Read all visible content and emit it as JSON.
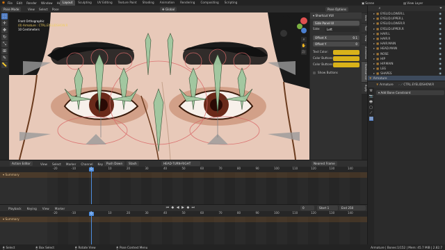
{
  "top_menu": {
    "items": [
      "File",
      "Edit",
      "Render",
      "Window",
      "Help"
    ],
    "workspaces": [
      "Layout",
      "Sculpting",
      "UV Editing",
      "Texture Paint",
      "Shading",
      "Animation",
      "Rendering",
      "Compositing",
      "Scripting"
    ],
    "active_workspace": "Layout",
    "scene_label": "Scene",
    "view_layer_label": "View Layer"
  },
  "viewport_header": {
    "mode": "Pose Mode",
    "menus": [
      "View",
      "Select",
      "Pose"
    ],
    "orientation": "Global",
    "pose_options": "Pose Options"
  },
  "viewport_info": {
    "line1": "Front Orthographic",
    "line2": "(0) Armature : CTRL.EYELIDSHOW.R",
    "line3": "10 Centimeters"
  },
  "side_panel": {
    "title": "Shortcut VUI",
    "dropdown": "Side Panel UI",
    "side_label": "Side:",
    "side_value": "Left",
    "offset_x_label": "Offset X",
    "offset_x_value": "0.1",
    "offset_y_label": "Offset Y",
    "offset_y_value": "0",
    "rows": [
      {
        "label": "Text Color:"
      },
      {
        "label": "Color Buttons:"
      },
      {
        "label": "Color Buttons ac:"
      }
    ],
    "show_buttons": "Show Buttons",
    "swatch_color": "#d9b21a",
    "tabs": [
      "Item",
      "Tool",
      "View",
      "Animation",
      "Shortcut VUI",
      "Rigify"
    ]
  },
  "outliner": {
    "items": [
      "EYELID.LOWER.L",
      "EYELID.UPPER.L",
      "EYELID.LOWER.R",
      "EYELID.UPPER.R",
      "HAIR.L",
      "HAIR.R",
      "HAIR.MAIN",
      "HEAD.MAIN",
      "NOSE",
      "HIP",
      "HIP.MAIN",
      "LEG",
      "SHAPES"
    ],
    "armature_row": "Armature"
  },
  "properties": {
    "object": "Armature",
    "bone": "CTRL.EYELIDSHOW.R",
    "add_constraint": "Add Bone Constraint"
  },
  "action_editor": {
    "mode": "Action Editor",
    "menus": [
      "View",
      "Select",
      "Marker",
      "Channel",
      "Key"
    ],
    "push_down": "Push Down",
    "stash": "Stash",
    "action_name": "HEAD-TURN-RIGHT",
    "snapping": "Nearest Frame",
    "summary": "Summary",
    "current_frame": "0",
    "ruler": [
      "-20",
      "-10",
      "0",
      "10",
      "20",
      "30",
      "40",
      "50",
      "60",
      "70",
      "80",
      "90",
      "100",
      "110",
      "120",
      "130",
      "140"
    ]
  },
  "timeline": {
    "menus": [
      "Playback",
      "Keying",
      "View",
      "Marker"
    ],
    "frame": "0",
    "start_label": "Start",
    "start": "1",
    "end_label": "End",
    "end": "250",
    "summary": "Summary",
    "ruler": [
      "-20",
      "-10",
      "0",
      "10",
      "20",
      "30",
      "40",
      "50",
      "60",
      "70",
      "80",
      "90",
      "100",
      "110",
      "120",
      "130",
      "140"
    ]
  },
  "status_bar": {
    "items": [
      "Select",
      "Box Select",
      "Rotate View",
      "Pose Context Menu"
    ],
    "right": "Armature | Bones:1/152 | Mem: 45.7 MiB | 2.82.7"
  }
}
